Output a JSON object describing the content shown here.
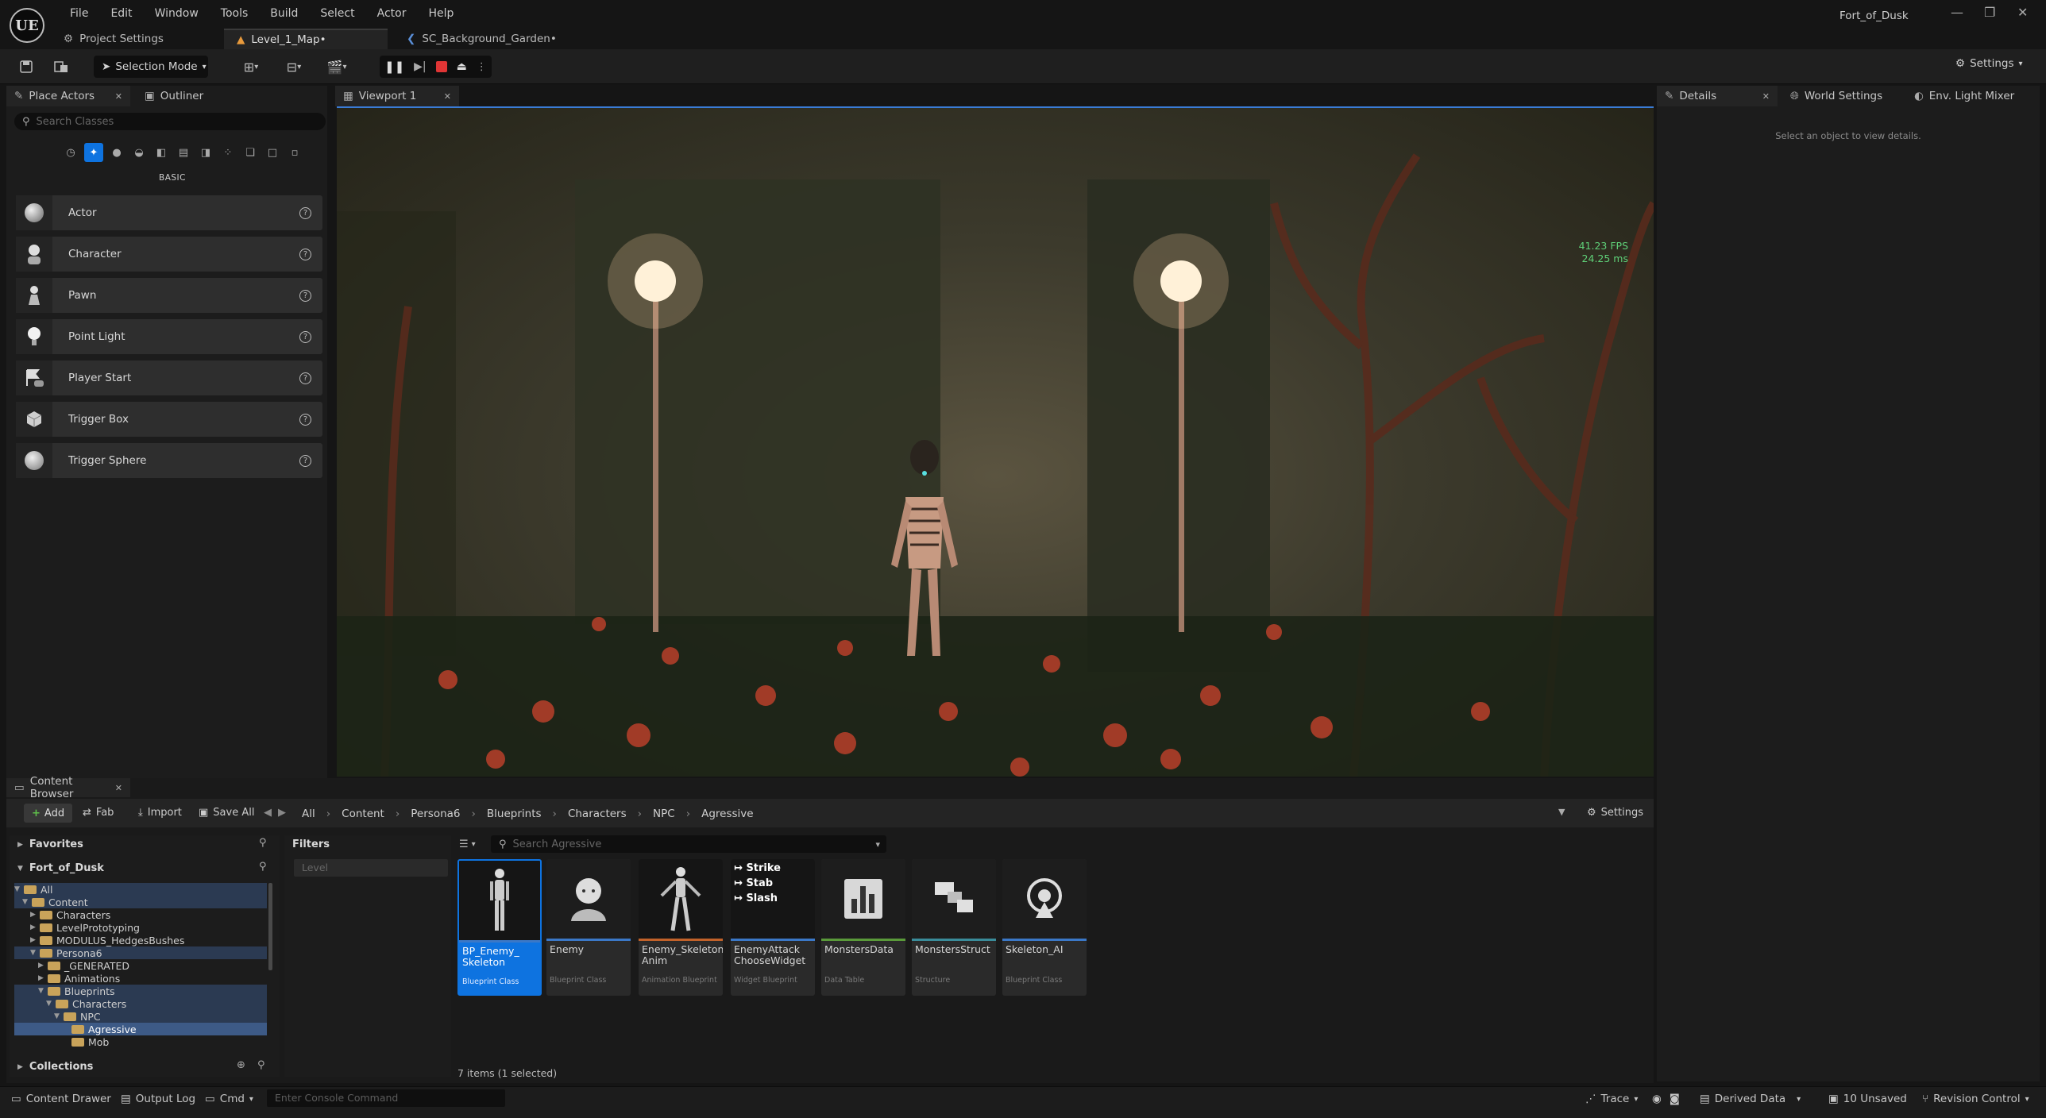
{
  "window": {
    "title": "Fort_of_Dusk",
    "app_logo": "UE"
  },
  "menu": [
    "File",
    "Edit",
    "Window",
    "Tools",
    "Build",
    "Select",
    "Actor",
    "Help"
  ],
  "doc_tabs": [
    {
      "label": "Project Settings",
      "icon": "gear-icon"
    },
    {
      "label": "Level_1_Map•",
      "icon": "level-icon"
    },
    {
      "label": "SC_Background_Garden•",
      "icon": "blueprint-icon"
    }
  ],
  "toolbar": {
    "selection_mode": "Selection Mode",
    "settings": "Settings"
  },
  "place_actors": {
    "tab": "Place Actors",
    "outliner_tab": "Outliner",
    "search_placeholder": "Search Classes",
    "category": "BASIC",
    "items": [
      "Actor",
      "Character",
      "Pawn",
      "Point Light",
      "Player Start",
      "Trigger Box",
      "Trigger Sphere"
    ]
  },
  "viewport": {
    "tab": "Viewport 1",
    "fps": "41.23 FPS",
    "ms": "24.25 ms"
  },
  "details": {
    "tab": "Details",
    "world_settings": "World Settings",
    "light_mixer": "Env. Light Mixer",
    "empty": "Select an object to view details."
  },
  "content_browser": {
    "tab": "Content Browser",
    "add": "Add",
    "fab": "Fab",
    "import": "Import",
    "save_all": "Save All",
    "breadcrumb": [
      "All",
      "Content",
      "Persona6",
      "Blueprints",
      "Characters",
      "NPC",
      "Agressive"
    ],
    "settings": "Settings",
    "favorites": "Favorites",
    "project": "Fort_of_Dusk",
    "tree": [
      {
        "label": "All",
        "depth": 0
      },
      {
        "label": "Content",
        "depth": 1
      },
      {
        "label": "Characters",
        "depth": 2
      },
      {
        "label": "LevelPrototyping",
        "depth": 2
      },
      {
        "label": "MODULUS_HedgesBushes",
        "depth": 2
      },
      {
        "label": "Persona6",
        "depth": 2
      },
      {
        "label": "_GENERATED",
        "depth": 3
      },
      {
        "label": "Animations",
        "depth": 3
      },
      {
        "label": "Blueprints",
        "depth": 3
      },
      {
        "label": "Characters",
        "depth": 4
      },
      {
        "label": "NPC",
        "depth": 5
      },
      {
        "label": "Agressive",
        "depth": 6
      },
      {
        "label": "Mob",
        "depth": 6
      }
    ],
    "collections": "Collections",
    "filters": "Filters",
    "filter_level": "Level",
    "search_placeholder": "Search Agressive",
    "assets": [
      {
        "name": "BP_Enemy_\nSkeleton",
        "type": "Blueprint Class",
        "color": "#3b78c7",
        "selected": true
      },
      {
        "name": "Enemy",
        "type": "Blueprint Class",
        "color": "#3b78c7"
      },
      {
        "name": "Enemy_Skeleton_\nAnim",
        "type": "Animation Blueprint",
        "color": "#c2622a"
      },
      {
        "name": "EnemyAttack\nChooseWidget",
        "type": "Widget Blueprint",
        "color": "#3b78c7"
      },
      {
        "name": "MonstersData",
        "type": "Data Table",
        "color": "#5a9a3a"
      },
      {
        "name": "MonstersStruct",
        "type": "Structure",
        "color": "#3a8c9a"
      },
      {
        "name": "Skeleton_AI",
        "type": "Blueprint Class",
        "color": "#3b78c7"
      }
    ],
    "widget_lines": [
      "Strike",
      "Stab",
      "Slash"
    ],
    "count": "7 items (1 selected)"
  },
  "status_bar": {
    "content_drawer": "Content Drawer",
    "output_log": "Output Log",
    "cmd": "Cmd",
    "console_placeholder": "Enter Console Command",
    "trace": "Trace",
    "derived_data": "Derived Data",
    "unsaved": "10 Unsaved",
    "revision": "Revision Control"
  }
}
